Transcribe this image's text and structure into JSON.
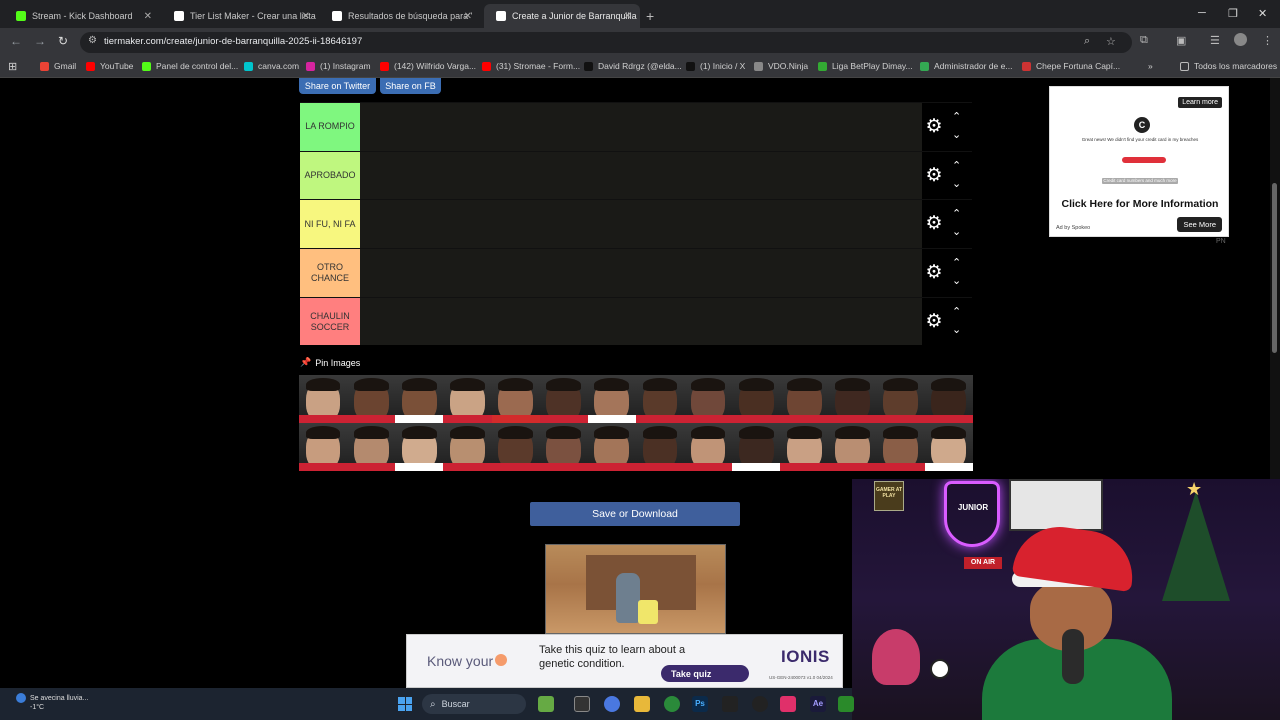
{
  "browser": {
    "tabs": [
      {
        "title": "Stream - Kick Dashboard",
        "icon": "kick-icon",
        "color": "#53fc18"
      },
      {
        "title": "Tier List Maker - Crear una lista",
        "icon": "tiermaker-icon",
        "color": "#ffffff"
      },
      {
        "title": "Resultados de búsqueda para '",
        "icon": "tiermaker-icon",
        "color": "#ffffff"
      },
      {
        "title": "Create a Junior de Barranquilla",
        "icon": "tiermaker-icon",
        "color": "#ffffff",
        "active": true
      }
    ],
    "new_tab": "+",
    "url": "tiermaker.com/create/junior-de-barranquilla-2025-ii-18646197",
    "bookmarks": [
      {
        "label": "Gmail",
        "color": "#ea4335"
      },
      {
        "label": "YouTube",
        "color": "#ff0000"
      },
      {
        "label": "Panel de control del...",
        "color": "#53fc18"
      },
      {
        "label": "canva.com",
        "color": "#00c4cc"
      },
      {
        "label": "(1) Instagram",
        "color": "#d6249f"
      },
      {
        "label": "(142) Wilfrido Varga...",
        "color": "#ff0000"
      },
      {
        "label": "(31) Stromae - Form...",
        "color": "#ff0000"
      },
      {
        "label": "David Rdrgz (@elda...",
        "color": "#111111"
      },
      {
        "label": "(1) Inicio / X",
        "color": "#111111"
      },
      {
        "label": "VDO.Ninja",
        "color": "#888888"
      },
      {
        "label": "Liga BetPlay Dimay...",
        "color": "#33aa33"
      },
      {
        "label": "Administrador de e...",
        "color": "#34a853"
      },
      {
        "label": "Chepe Fortuna Capí...",
        "color": "#cc3333"
      }
    ],
    "bookmarks_overflow": "»",
    "all_bookmarks": "Todos los marcadores"
  },
  "share": {
    "twitter": "Share on Twitter",
    "facebook": "Share on FB"
  },
  "tiers": [
    {
      "label": "LA ROMPIO",
      "color": "#7ff77f"
    },
    {
      "label": "APROBADO",
      "color": "#bff77f"
    },
    {
      "label": "NI FU, NI FA",
      "color": "#f7f77f"
    },
    {
      "label": "OTRO CHANCE",
      "color": "#ffbf7f"
    },
    {
      "label": "CHAULIN SOCCER",
      "color": "#ff7f7f"
    }
  ],
  "pin_images_label": "Pin Images",
  "players": [
    {
      "skin": "#c9a184",
      "shirt": "#cc2233"
    },
    {
      "skin": "#6b4430",
      "shirt": "#cc2233"
    },
    {
      "skin": "#7a5038",
      "shirt": "#ffffff"
    },
    {
      "skin": "#caa385",
      "shirt": "#cc2233"
    },
    {
      "skin": "#9b6a50",
      "shirt": "#d32b2b"
    },
    {
      "skin": "#4e3226",
      "shirt": "#cc2233"
    },
    {
      "skin": "#a4755a",
      "shirt": "#ffffff"
    },
    {
      "skin": "#5a3a2a",
      "shirt": "#cc2233"
    },
    {
      "skin": "#70483a",
      "shirt": "#cc2233"
    },
    {
      "skin": "#4a2f22",
      "shirt": "#cc2233"
    },
    {
      "skin": "#6e4533",
      "shirt": "#cc2233"
    },
    {
      "skin": "#3f2820",
      "shirt": "#cc2233"
    },
    {
      "skin": "#5e3d2c",
      "shirt": "#cc2233"
    },
    {
      "skin": "#3a251c",
      "shirt": "#cc2233"
    },
    {
      "skin": "#c79c7e",
      "shirt": "#cc2233"
    },
    {
      "skin": "#b48a6e",
      "shirt": "#cc2233"
    },
    {
      "skin": "#d0ab8e",
      "shirt": "#ffffff"
    },
    {
      "skin": "#b88f70",
      "shirt": "#cc2233"
    },
    {
      "skin": "#5b3a2b",
      "shirt": "#cc2233"
    },
    {
      "skin": "#7b5140",
      "shirt": "#cc2233"
    },
    {
      "skin": "#a37559",
      "shirt": "#cc2233"
    },
    {
      "skin": "#4b3024",
      "shirt": "#cc2233"
    },
    {
      "skin": "#c09477",
      "shirt": "#cc2233"
    },
    {
      "skin": "#3c2820",
      "shirt": "#ffffff"
    },
    {
      "skin": "#c9a084",
      "shirt": "#cc2233"
    },
    {
      "skin": "#b98e72",
      "shirt": "#cc2233"
    },
    {
      "skin": "#8a5e47",
      "shirt": "#cc2233"
    },
    {
      "skin": "#cfa98c",
      "shirt": "#ffffff"
    }
  ],
  "save_button": "Save or Download",
  "ad_right": {
    "learn_more": "Learn more",
    "logo": "C",
    "line1": "Great news! We didn't find your credit card in my breaches",
    "line2": "Credit card numbers and much more",
    "cta": "Click Here for More Information",
    "ad_by": "Ad by Spokeo",
    "see_more": "See More",
    "pn": "PN"
  },
  "ad_banner": {
    "know_your": "Know your",
    "text": "Take this quiz to learn about a genetic condition.",
    "take_quiz": "Take quiz",
    "brand": "IONIS",
    "fine_print": "US-GEN-2400073 v1.0 04/2024"
  },
  "webcam": {
    "crest_text": "JUNIOR",
    "on_air": "ON AIR",
    "shelf_text": "GAMER AT PLAY"
  },
  "taskbar": {
    "weather_line1": "Se avecina lluvia...",
    "weather_line2": "-1°C",
    "search_placeholder": "Buscar"
  }
}
